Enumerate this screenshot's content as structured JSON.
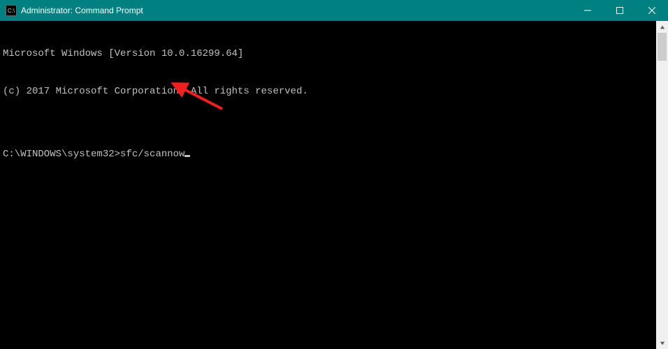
{
  "window": {
    "title": "Administrator: Command Prompt"
  },
  "terminal": {
    "line1": "Microsoft Windows [Version 10.0.16299.64]",
    "line2": "(c) 2017 Microsoft Corporation. All rights reserved.",
    "blank": "",
    "prompt": "C:\\WINDOWS\\system32>",
    "command": "sfc/scannow"
  }
}
